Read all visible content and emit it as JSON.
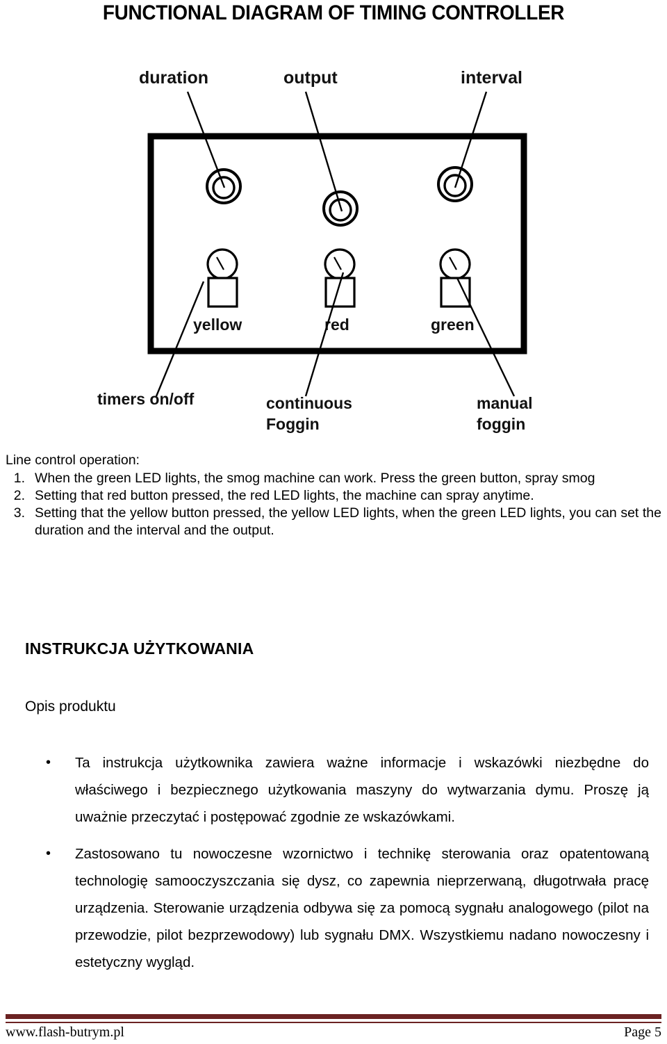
{
  "document": {
    "title": "FUNCTIONAL DIAGRAM OF TIMING CONTROLLER"
  },
  "diagram": {
    "top_labels": [
      {
        "id": "duration",
        "text": "duration"
      },
      {
        "id": "output",
        "text": "output"
      },
      {
        "id": "interval",
        "text": "interval"
      }
    ],
    "led_labels": [
      {
        "id": "yellow",
        "text": "yellow"
      },
      {
        "id": "red",
        "text": "red"
      },
      {
        "id": "green",
        "text": "green"
      }
    ],
    "bottom_labels": [
      {
        "id": "timers-on-off",
        "line1": "timers on/off",
        "line2": ""
      },
      {
        "id": "continuous-foggin",
        "line1": "continuous",
        "line2": "Foggin"
      },
      {
        "id": "manual-foggin",
        "line1": "manual",
        "line2": "foggin"
      }
    ]
  },
  "english": {
    "lead": "Line control operation:",
    "items": [
      {
        "number": "1.",
        "text": "When the green LED lights, the smog machine can work. Press the green button, spray smog"
      },
      {
        "number": "2.",
        "text": "Setting that red button pressed, the red LED lights, the machine can spray anytime."
      },
      {
        "number": "3.",
        "text": "Setting that the yellow button pressed, the yellow LED lights, when the green LED lights, you can set the duration and the interval and the output."
      }
    ]
  },
  "polish": {
    "heading": "INSTRUKCJA UŻYTKOWANIA",
    "subheading": "Opis produktu",
    "bullet_glyph": "•",
    "bullets": [
      "Ta instrukcja użytkownika zawiera ważne informacje i wskazówki niezbędne do właściwego i bezpiecznego użytkowania maszyny do wytwarzania dymu. Proszę ją uważnie przeczytać i postępować zgodnie ze wskazówkami.",
      "Zastosowano tu nowoczesne wzornictwo i technikę sterowania oraz opatentowaną technologię samooczyszczania się dysz, co zapewnia nieprzerwaną, długotrwała pracę urządzenia. Sterowanie urządzenia odbywa się za pomocą sygnału analogowego (pilot na przewodzie, pilot bezprzewodowy) lub sygnału DMX. Wszystkiemu nadano nowoczesny i estetyczny wygląd."
    ]
  },
  "footer": {
    "website": "www.flash-butrym.pl",
    "page": "Page 5",
    "rule_color": "#6b2222"
  }
}
